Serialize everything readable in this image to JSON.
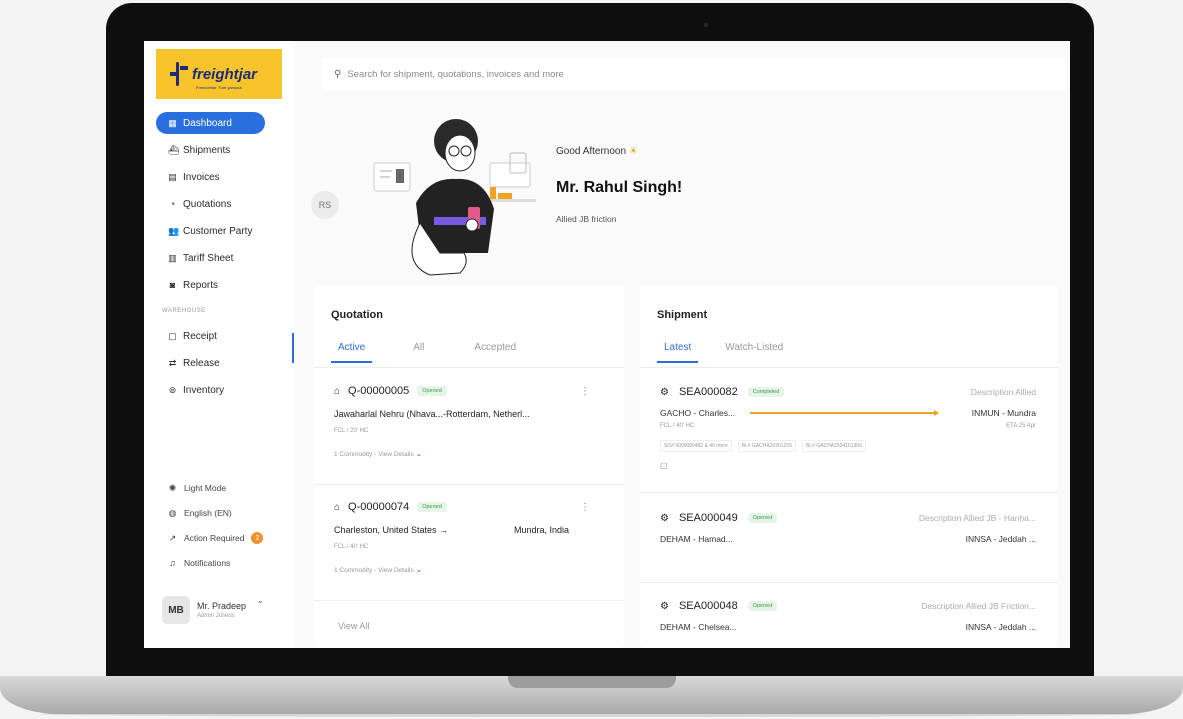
{
  "app": {
    "logo_text": "freightjar",
    "logo_tagline": "Freedomlar. Tum yamuna"
  },
  "search": {
    "placeholder": "Search for shipment, quotations, invoices and more"
  },
  "sidebar": {
    "items": [
      {
        "label": "Dashboard",
        "icon": "dashboard-icon",
        "active": true
      },
      {
        "label": "Shipments",
        "icon": "ship-icon"
      },
      {
        "label": "Invoices",
        "icon": "invoice-icon"
      },
      {
        "label": "Quotations",
        "icon": "quotation-icon"
      },
      {
        "label": "Customer Party",
        "icon": "users-icon"
      },
      {
        "label": "Tariff Sheet",
        "icon": "sheet-icon"
      },
      {
        "label": "Reports",
        "icon": "report-icon"
      }
    ],
    "section_label": "WAREHOUSE",
    "warehouse_items": [
      {
        "label": "Receipt",
        "icon": "receipt-icon"
      },
      {
        "label": "Release",
        "icon": "release-icon"
      },
      {
        "label": "Inventory",
        "icon": "inventory-icon"
      }
    ],
    "bottom": [
      {
        "label": "Light Mode",
        "icon": "sun-icon"
      },
      {
        "label": "English (EN)",
        "icon": "globe-icon"
      },
      {
        "label": "Action Required",
        "icon": "action-icon",
        "badge": "2"
      },
      {
        "label": "Notifications",
        "icon": "bell-icon"
      }
    ],
    "user": {
      "initials": "MB",
      "name": "Mr. Pradeep",
      "role": "Admin Joseos"
    }
  },
  "hero": {
    "initials": "RS",
    "greeting": "Good Afternoon",
    "name": "Mr. Rahul Singh!",
    "company": "Allied JB friction"
  },
  "quotation": {
    "title": "Quotation",
    "tabs": [
      "Active",
      "All",
      "Accepted"
    ],
    "items": [
      {
        "id": "Q-00000005",
        "status": "Opened",
        "route": "Jawaharlal Nehru (Nhava...-Rotterdam, Netherl...",
        "spec": "FCL / 20' HC",
        "commodity": "1 Commodity - View Details"
      },
      {
        "id": "Q-00000074",
        "status": "Opened",
        "route": "Charleston, United States →",
        "route_to": "Mundra, India",
        "spec": "FCL / 40' HC",
        "commodity": "1 Commodity - View Details"
      }
    ],
    "view_all": "View All"
  },
  "shipment": {
    "title": "Shipment",
    "tabs": [
      "Latest",
      "Watch-Listed"
    ],
    "items": [
      {
        "id": "SEA000082",
        "status": "Completed",
        "description": "Description Allied",
        "from": "GACHO - Charles...",
        "to": "INMUN - Mundra",
        "spec": "FCL / 40' HC",
        "eta": "ETA 25 Apr",
        "tags": [
          "SO# 5000000482 & 40 more",
          "BL# GACHA20261255",
          "BL# GACHA2504161306"
        ]
      },
      {
        "id": "SEA000049",
        "status": "Opened",
        "description": "Description Allied JB - Hanha...",
        "from": "DEHAM - Hamad...",
        "to": "INNSA - Jeddah ..."
      },
      {
        "id": "SEA000048",
        "status": "Opened",
        "description": "Description Allied JB Friction...",
        "from": "DEHAM - Chelsea...",
        "to": "INNSA - Jeddah ..."
      }
    ]
  },
  "colors": {
    "brand_yellow": "#f7c42c",
    "accent_blue": "#2a6fe0",
    "route_orange": "#f0a323",
    "status_green": "#3a9a4a"
  }
}
